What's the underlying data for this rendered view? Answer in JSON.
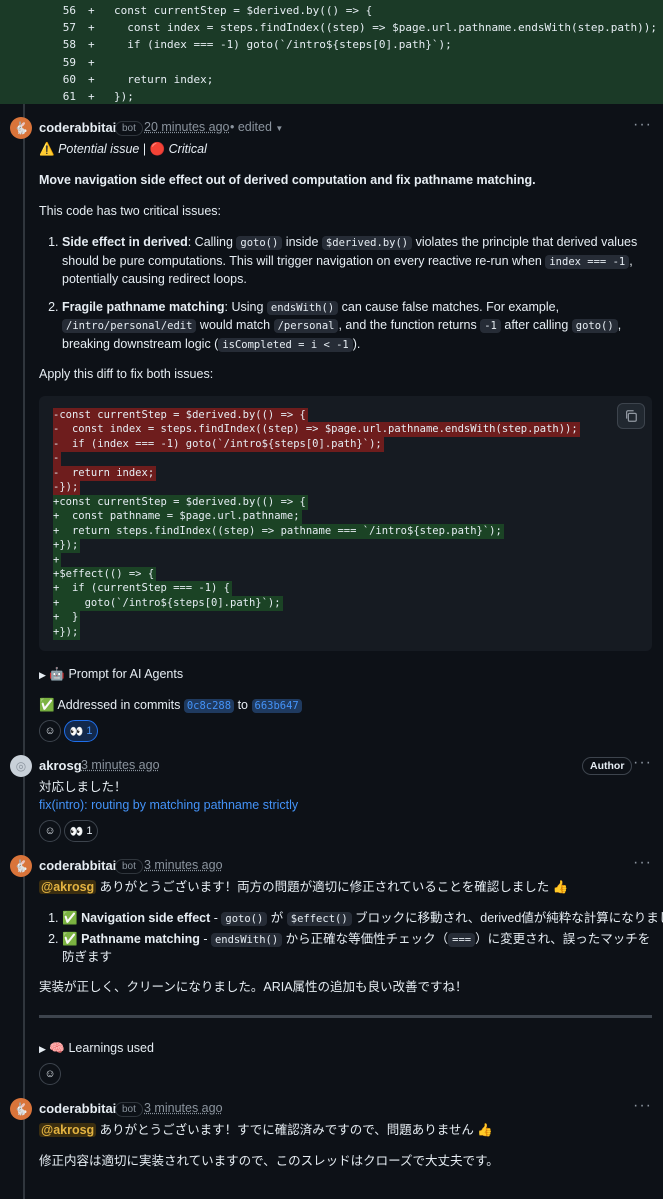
{
  "diff": {
    "lines": [
      {
        "num": "56",
        "sign": "+",
        "code": "const currentStep = $derived.by(() => {"
      },
      {
        "num": "57",
        "sign": "+",
        "code": "  const index = steps.findIndex((step) => $page.url.pathname.endsWith(step.path));"
      },
      {
        "num": "58",
        "sign": "+",
        "code": "  if (index === -1) goto(`/intro${steps[0].path}`);"
      },
      {
        "num": "59",
        "sign": "+",
        "code": ""
      },
      {
        "num": "60",
        "sign": "+",
        "code": "  return index;"
      },
      {
        "num": "61",
        "sign": "+",
        "code": "});"
      }
    ]
  },
  "comment1": {
    "user": "coderabbitai",
    "badge": "bot",
    "time": "20 minutes ago",
    "edited": "• edited",
    "tag_icon": "⚠️",
    "tag_issue": "Potential issue",
    "tag_sep": "|",
    "tag_crit_icon": "🔴",
    "tag_crit": "Critical",
    "heading": "Move navigation side effect out of derived computation and fix pathname matching.",
    "intro": "This code has two critical issues:",
    "item1_title": "Side effect in derived",
    "item1_a": ": Calling ",
    "item1_code1": "goto()",
    "item1_b": " inside ",
    "item1_code2": "$derived.by()",
    "item1_c": " violates the principle that derived values should be pure computations. This will trigger navigation on every reactive re-run when ",
    "item1_code3": "index === -1",
    "item1_d": ", potentially causing redirect loops.",
    "item2_title": "Fragile pathname matching",
    "item2_a": ": Using ",
    "item2_code1": "endsWith()",
    "item2_b": " can cause false matches. For example, ",
    "item2_code2": "/intro/personal/edit",
    "item2_c": " would match ",
    "item2_code3": "/personal",
    "item2_d": ", and the function returns ",
    "item2_code4": "-1",
    "item2_e": " after calling ",
    "item2_code5": "goto()",
    "item2_f": ", breaking downstream logic (",
    "item2_code6": "isCompleted = i < -1",
    "item2_g": ").",
    "apply": "Apply this diff to fix both issues:",
    "suggestion": [
      {
        "type": "del",
        "text": "-const currentStep = $derived.by(() => {"
      },
      {
        "type": "del",
        "text": "-  const index = steps.findIndex((step) => $page.url.pathname.endsWith(step.path));"
      },
      {
        "type": "del",
        "text": "-  if (index === -1) goto(`/intro${steps[0].path}`);"
      },
      {
        "type": "del",
        "text": "-"
      },
      {
        "type": "del",
        "text": "-  return index;"
      },
      {
        "type": "del",
        "text": "-});"
      },
      {
        "type": "add",
        "text": "+const currentStep = $derived.by(() => {"
      },
      {
        "type": "add",
        "text": "+  const pathname = $page.url.pathname;"
      },
      {
        "type": "add",
        "text": "+  return steps.findIndex((step) => pathname === `/intro${step.path}`);"
      },
      {
        "type": "add",
        "text": "+});"
      },
      {
        "type": "add",
        "text": "+"
      },
      {
        "type": "add",
        "text": "+$effect(() => {"
      },
      {
        "type": "add",
        "text": "+  if (currentStep === -1) {"
      },
      {
        "type": "add",
        "text": "+    goto(`/intro${steps[0].path}`);"
      },
      {
        "type": "add",
        "text": "+  }"
      },
      {
        "type": "add",
        "text": "+});"
      }
    ],
    "prompt_icon": "🤖",
    "prompt_label": "Prompt for AI Agents",
    "addressed_icon": "✅",
    "addressed_text": "Addressed in commits",
    "commit1": "0c8c288",
    "commit_to": "to",
    "commit2": "663b647",
    "reaction_emoji": "👀",
    "reaction_count": "1"
  },
  "comment2": {
    "user": "akrosg",
    "time": "3 minutes ago",
    "author_badge": "Author",
    "line1": "対応しました！",
    "link": "fix(intro): routing by matching pathname strictly",
    "reaction_emoji": "👀",
    "reaction_count": "1"
  },
  "comment3": {
    "user": "coderabbitai",
    "badge": "bot",
    "time": "3 minutes ago",
    "mention": "@akrosg",
    "line1": " ありがとうございます！両方の問題が適切に修正されていることを確認しました 👍",
    "item1_icon": "✅",
    "item1_title": "Navigation side effect",
    "item1_a": " - ",
    "item1_code1": "goto()",
    "item1_b": " が ",
    "item1_code2": "$effect()",
    "item1_c": " ブロックに移動され、derived値が純粋な計算になりました",
    "item2_icon": "✅",
    "item2_title": "Pathname matching",
    "item2_a": " - ",
    "item2_code1": "endsWith()",
    "item2_b": " から正確な等価性チェック（",
    "item2_code2": "===",
    "item2_c": "）に変更され、誤ったマッチを防ぎます",
    "summary": "実装が正しく、クリーンになりました。ARIA属性の追加も良い改善ですね！",
    "learnings_icon": "🧠",
    "learnings_label": "Learnings used"
  },
  "comment4": {
    "user": "coderabbitai",
    "badge": "bot",
    "time": "3 minutes ago",
    "mention": "@akrosg",
    "line1": " ありがとうございます！すでに確認済みですので、問題ありません 👍",
    "line2": "修正内容は適切に実装されていますので、このスレッドはクローズで大丈夫です。"
  },
  "menu_glyph": "···"
}
